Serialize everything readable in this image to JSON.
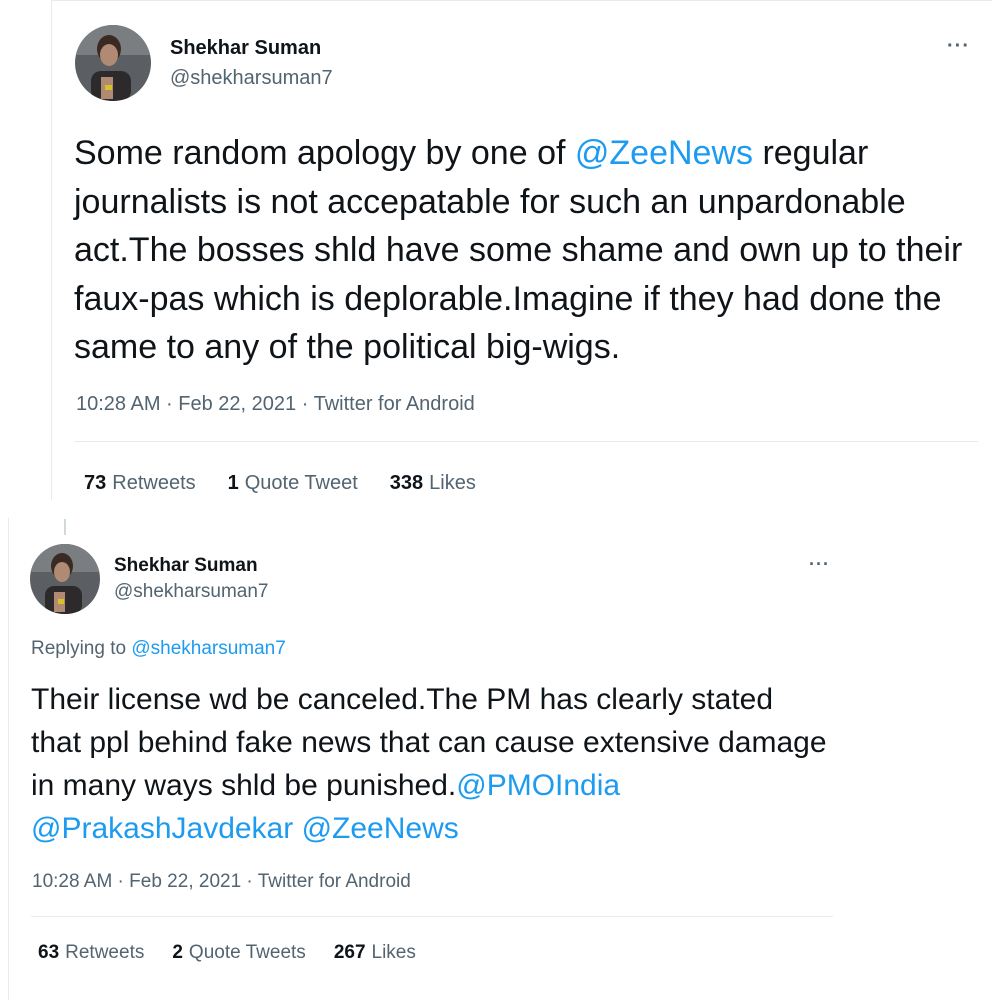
{
  "tweets": [
    {
      "author": {
        "name": "Shekhar Suman",
        "handle": "@shekharsuman7"
      },
      "more_label": "···",
      "text_parts": [
        {
          "text": "Some random apology by one of ",
          "mention": false
        },
        {
          "text": "@ZeeNews",
          "mention": true
        },
        {
          "text": " regular journalists is not accepatable for such an unpardonable act.The bosses shld have some shame and own up to their faux-pas which is deplorable.Imagine if they had done the same to any of the political big-wigs.",
          "mention": false
        }
      ],
      "timestamp": "10:28 AM · Feb 22, 2021",
      "separator": "·",
      "source": "Twitter for Android",
      "stats": {
        "retweets": {
          "count": "73",
          "label": "Retweets"
        },
        "quotes": {
          "count": "1",
          "label": "Quote Tweet"
        },
        "likes": {
          "count": "338",
          "label": "Likes"
        }
      }
    },
    {
      "author": {
        "name": "Shekhar Suman",
        "handle": "@shekharsuman7"
      },
      "more_label": "···",
      "replying_to": {
        "prefix": "Replying to",
        "handle": "@shekharsuman7"
      },
      "text_parts": [
        {
          "text": "Their license wd be canceled.The PM has clearly stated that ppl behind fake news that can cause extensive damage in many ways shld be punished.",
          "mention": false
        },
        {
          "text": "@PMOIndia",
          "mention": true
        },
        {
          "text": " ",
          "mention": false
        },
        {
          "text": "@PrakashJavdekar",
          "mention": true
        },
        {
          "text": " ",
          "mention": false
        },
        {
          "text": "@ZeeNews",
          "mention": true
        }
      ],
      "timestamp": "10:28 AM · Feb 22, 2021",
      "separator": "·",
      "source": "Twitter for Android",
      "stats": {
        "retweets": {
          "count": "63",
          "label": "Retweets"
        },
        "quotes": {
          "count": "2",
          "label": "Quote Tweets"
        },
        "likes": {
          "count": "267",
          "label": "Likes"
        }
      }
    }
  ],
  "colors": {
    "link": "#1d9bf0",
    "secondary": "#536471",
    "text": "#0f1419",
    "border": "#e6ecf0"
  }
}
